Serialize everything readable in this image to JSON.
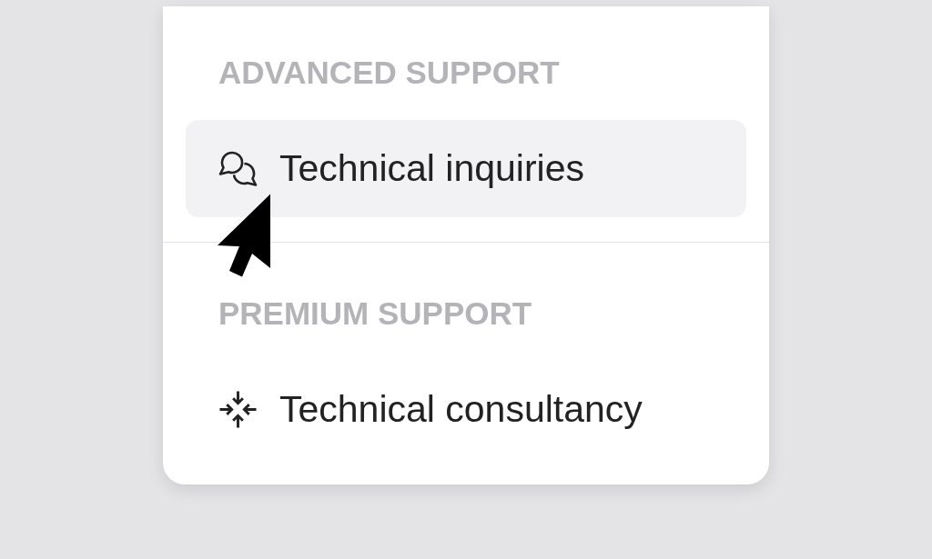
{
  "sections": [
    {
      "heading": "ADVANCED SUPPORT",
      "items": [
        {
          "label": "Technical inquiries",
          "selected": true
        }
      ]
    },
    {
      "heading": "PREMIUM SUPPORT",
      "items": [
        {
          "label": "Technical consultancy",
          "selected": false
        }
      ]
    }
  ]
}
